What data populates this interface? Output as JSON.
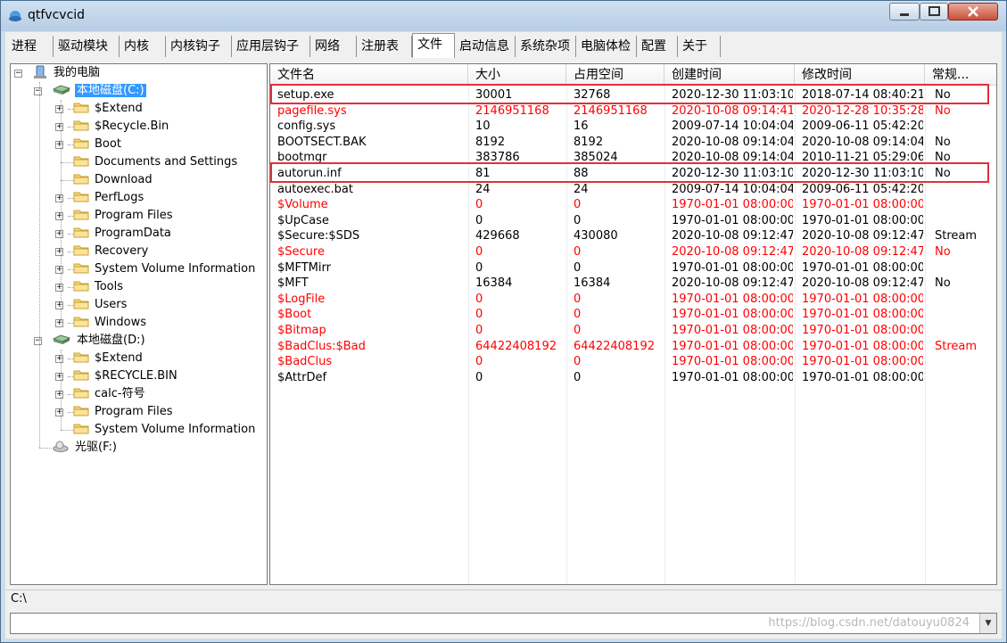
{
  "window": {
    "title": "qtfvcvcid"
  },
  "tabs": [
    "进程",
    "驱动模块",
    "内核",
    "内核钩子",
    "应用层钩子",
    "网络",
    "注册表",
    "文件",
    "启动信息",
    "系统杂项",
    "电脑体检",
    "配置",
    "关于"
  ],
  "active_tab": "文件",
  "tree": {
    "root": "我的电脑",
    "drive_c": "本地磁盘(C:)",
    "c_items": [
      "$Extend",
      "$Recycle.Bin",
      "Boot",
      "Documents and Settings",
      "Download",
      "PerfLogs",
      "Program Files",
      "ProgramData",
      "Recovery",
      "System Volume Information",
      "Tools",
      "Users",
      "Windows"
    ],
    "drive_d": "本地磁盘(D:)",
    "d_items": [
      "$Extend",
      "$RECYCLE.BIN",
      "calc-符号",
      "Program Files",
      "System Volume Information"
    ],
    "drive_f": "光驱(F:)"
  },
  "list": {
    "columns": [
      "文件名",
      "大小",
      "占用空间",
      "创建时间",
      "修改时间",
      "常规..."
    ],
    "rows": [
      {
        "name": "setup.exe",
        "size": "30001",
        "alloc": "32768",
        "created": "2020-12-30 11:03:10",
        "modified": "2018-07-14 08:40:21",
        "normal": "No",
        "red": false,
        "highlight": true
      },
      {
        "name": "pagefile.sys",
        "size": "2146951168",
        "alloc": "2146951168",
        "created": "2020-10-08 09:14:41",
        "modified": "2020-12-28 10:35:28",
        "normal": "No",
        "red": true
      },
      {
        "name": "config.sys",
        "size": "10",
        "alloc": "16",
        "created": "2009-07-14 10:04:04",
        "modified": "2009-06-11 05:42:20",
        "normal": "",
        "red": false
      },
      {
        "name": "BOOTSECT.BAK",
        "size": "8192",
        "alloc": "8192",
        "created": "2020-10-08 09:14:04",
        "modified": "2020-10-08 09:14:04",
        "normal": "No",
        "red": false
      },
      {
        "name": "bootmgr",
        "size": "383786",
        "alloc": "385024",
        "created": "2020-10-08 09:14:04",
        "modified": "2010-11-21 05:29:06",
        "normal": "No",
        "red": false
      },
      {
        "name": "autorun.inf",
        "size": "81",
        "alloc": "88",
        "created": "2020-12-30 11:03:10",
        "modified": "2020-12-30 11:03:10",
        "normal": "No",
        "red": false,
        "highlight": true
      },
      {
        "name": "autoexec.bat",
        "size": "24",
        "alloc": "24",
        "created": "2009-07-14 10:04:04",
        "modified": "2009-06-11 05:42:20",
        "normal": "",
        "red": false
      },
      {
        "name": "$Volume",
        "size": "0",
        "alloc": "0",
        "created": "1970-01-01 08:00:00",
        "modified": "1970-01-01 08:00:00",
        "normal": "",
        "red": true
      },
      {
        "name": "$UpCase",
        "size": "0",
        "alloc": "0",
        "created": "1970-01-01 08:00:00",
        "modified": "1970-01-01 08:00:00",
        "normal": "",
        "red": false
      },
      {
        "name": "$Secure:$SDS",
        "size": "429668",
        "alloc": "430080",
        "created": "2020-10-08 09:12:47",
        "modified": "2020-10-08 09:12:47",
        "normal": "Stream",
        "red": false
      },
      {
        "name": "$Secure",
        "size": "0",
        "alloc": "0",
        "created": "2020-10-08 09:12:47",
        "modified": "2020-10-08 09:12:47",
        "normal": "No",
        "red": true
      },
      {
        "name": "$MFTMirr",
        "size": "0",
        "alloc": "0",
        "created": "1970-01-01 08:00:00",
        "modified": "1970-01-01 08:00:00",
        "normal": "",
        "red": false
      },
      {
        "name": "$MFT",
        "size": "16384",
        "alloc": "16384",
        "created": "2020-10-08 09:12:47",
        "modified": "2020-10-08 09:12:47",
        "normal": "No",
        "red": false
      },
      {
        "name": "$LogFile",
        "size": "0",
        "alloc": "0",
        "created": "1970-01-01 08:00:00",
        "modified": "1970-01-01 08:00:00",
        "normal": "",
        "red": true
      },
      {
        "name": "$Boot",
        "size": "0",
        "alloc": "0",
        "created": "1970-01-01 08:00:00",
        "modified": "1970-01-01 08:00:00",
        "normal": "",
        "red": true
      },
      {
        "name": "$Bitmap",
        "size": "0",
        "alloc": "0",
        "created": "1970-01-01 08:00:00",
        "modified": "1970-01-01 08:00:00",
        "normal": "",
        "red": true
      },
      {
        "name": "$BadClus:$Bad",
        "size": "64422408192",
        "alloc": "64422408192",
        "created": "1970-01-01 08:00:00",
        "modified": "1970-01-01 08:00:00",
        "normal": "Stream",
        "red": true
      },
      {
        "name": "$BadClus",
        "size": "0",
        "alloc": "0",
        "created": "1970-01-01 08:00:00",
        "modified": "1970-01-01 08:00:00",
        "normal": "",
        "red": true
      },
      {
        "name": "$AttrDef",
        "size": "0",
        "alloc": "0",
        "created": "1970-01-01 08:00:00",
        "modified": "1970-01-01 08:00:00",
        "normal": "",
        "red": false
      }
    ]
  },
  "status": {
    "path": "C:\\"
  },
  "watermark": "https://blog.csdn.net/datouyu0824",
  "colors": {
    "highlight_box": "#e0303a",
    "system_file_red": "#ff0000",
    "selection": "#3399ff"
  }
}
